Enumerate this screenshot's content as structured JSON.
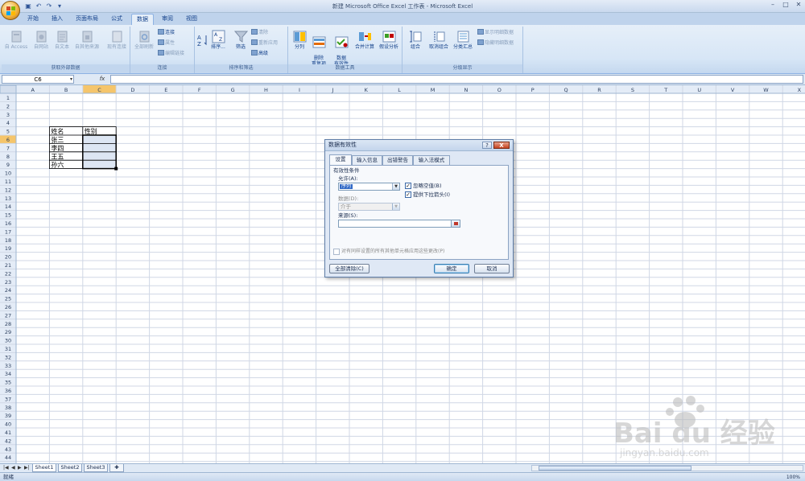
{
  "window": {
    "title": "新建 Microsoft Office Excel 工作表 - Microsoft Excel"
  },
  "ribbon_tabs": [
    "开始",
    "插入",
    "页面布局",
    "公式",
    "数据",
    "审阅",
    "视图"
  ],
  "active_tab": "数据",
  "ribbon": {
    "external": {
      "label": "获取外部数据",
      "buttons": [
        "自 Access",
        "自网站",
        "自文本",
        "自其他来源",
        "现有连接"
      ]
    },
    "connections": {
      "label": "连接",
      "refresh": "全部刷新",
      "items": [
        "连接",
        "属性",
        "编辑链接"
      ]
    },
    "sort_filter": {
      "label": "排序和筛选",
      "sort": "排序...",
      "filter": "筛选",
      "items": [
        "清除",
        "重新应用",
        "高级"
      ]
    },
    "data_tools": {
      "label": "数据工具",
      "buttons": [
        "分列",
        "删除\n重复项",
        "数据\n有效性",
        "合并计算",
        "假设分析"
      ]
    },
    "outline": {
      "label": "分级显示",
      "buttons": [
        "组合",
        "取消组合",
        "分类汇总"
      ],
      "items": [
        "显示明细数据",
        "隐藏明细数据"
      ]
    }
  },
  "formula_bar": {
    "name_box": "C6",
    "fx": "fx",
    "value": ""
  },
  "sheet": {
    "columns": [
      "A",
      "B",
      "C",
      "D",
      "E",
      "F",
      "G",
      "H",
      "I",
      "J",
      "K",
      "L",
      "M",
      "N",
      "O",
      "P",
      "Q",
      "R",
      "S",
      "T",
      "U",
      "V",
      "W",
      "X"
    ],
    "row_count": 44,
    "selected_cell": "C6",
    "cells": {
      "B5": "姓名",
      "C5": "性别",
      "B6": "张三",
      "B7": "李四",
      "B8": "王五",
      "B9": "孙六"
    }
  },
  "dialog": {
    "title": "数据有效性",
    "help": "?",
    "close": "X",
    "tabs": [
      "设置",
      "输入信息",
      "出错警告",
      "输入法模式"
    ],
    "active_tab": "设置",
    "section": "有效性条件",
    "allow_label": "允许(A):",
    "allow_value": "序列",
    "ignore_blank": "忽略空值(B)",
    "ignore_blank_checked": true,
    "dropdown": "提供下拉箭头(I)",
    "dropdown_checked": true,
    "data_label": "数据(D):",
    "data_value": "介于",
    "source_label": "来源(S):",
    "source_value": "",
    "apply_all": "对有同样设置的所有其他单元格应用这些更改(P)",
    "apply_all_checked": false,
    "clear_all": "全部清除(C)",
    "ok": "确定",
    "cancel": "取消"
  },
  "sheet_tabs": [
    "Sheet1",
    "Sheet2",
    "Sheet3"
  ],
  "active_sheet": "Sheet1",
  "status": {
    "text": "就绪",
    "zoom": "100%"
  },
  "watermark": {
    "brand": "Bai du 经验",
    "url": "jingyan.baidu.com"
  },
  "colors": {
    "accent": "#15428b",
    "arrow": "#e8302a",
    "selection": "#f5c56b"
  }
}
